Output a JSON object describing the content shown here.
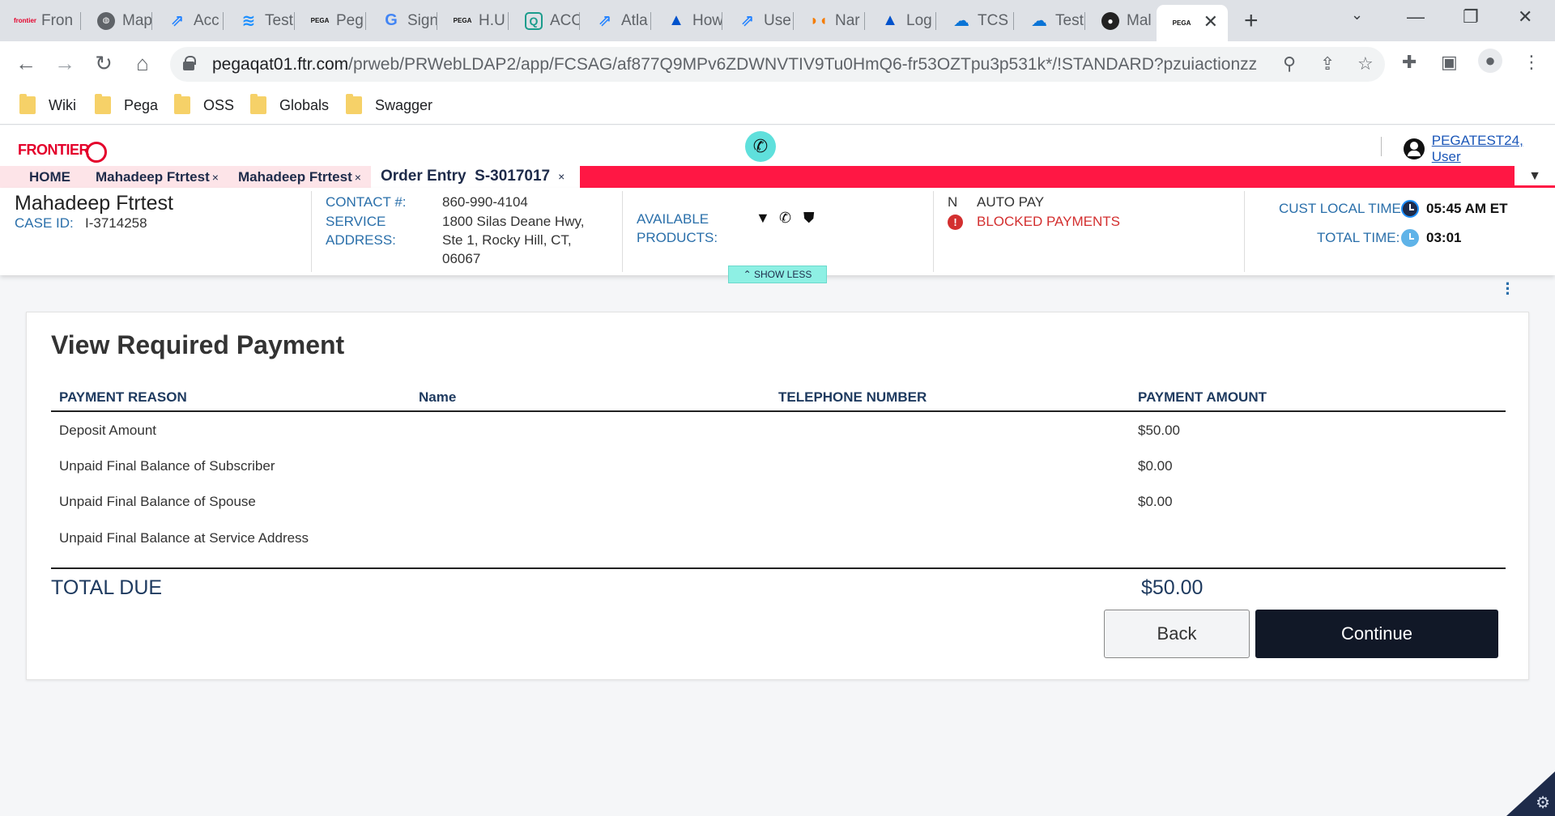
{
  "browser": {
    "tabs": [
      {
        "label": "Fron",
        "icon": "frontier-favicon"
      },
      {
        "label": "Map",
        "icon": "globe-favicon"
      },
      {
        "label": "Acc",
        "icon": "jira-favicon"
      },
      {
        "label": "Test",
        "icon": "feather-favicon"
      },
      {
        "label": "Peg",
        "icon": "pega-favicon"
      },
      {
        "label": "Sign",
        "icon": "google-favicon"
      },
      {
        "label": "H.U",
        "icon": "pega-favicon"
      },
      {
        "label": "ACC",
        "icon": "q-favicon"
      },
      {
        "label": "Atla",
        "icon": "jira-favicon"
      },
      {
        "label": "How",
        "icon": "atlassian-favicon"
      },
      {
        "label": "Use",
        "icon": "jira-favicon"
      },
      {
        "label": "Nar",
        "icon": "mask-favicon"
      },
      {
        "label": "Log",
        "icon": "atlassian-favicon"
      },
      {
        "label": "TCS",
        "icon": "cloud-favicon"
      },
      {
        "label": "Test",
        "icon": "cloud-favicon"
      },
      {
        "label": "Mal",
        "icon": "github-favicon"
      },
      {
        "label": "",
        "icon": "pega-favicon"
      }
    ],
    "pega_badge": "PEGA",
    "frontier_badge": "frontier",
    "url_host": "pegaqat01.ftr.com",
    "url_path": "/prweb/PRWebLDAP2/app/FCSAG/af877Q9MPv6ZDWNVTIV9Tu0HmQ6-fr53OZTpu3p531k*/!STANDARD?pzuiactionzzz...",
    "bookmarks": [
      "Wiki",
      "Pega",
      "OSS",
      "Globals",
      "Swagger"
    ]
  },
  "app": {
    "logo_text": "FRONTIER",
    "user_label": "PEGATEST24, User",
    "tabs": [
      {
        "label": "HOME"
      },
      {
        "label": "Mahadeep Ftrtest"
      },
      {
        "label": "Mahadeep Ftrtest"
      },
      {
        "label": "Order Entry  S-3017017"
      }
    ],
    "close_glyph": "×",
    "menu_glyph": "▼"
  },
  "summary": {
    "customer_name": "Mahadeep Ftrtest",
    "case_id_label": "CASE ID:",
    "case_id": "I-3714258",
    "contact_label": "CONTACT #:",
    "contact": "860-990-4104",
    "service_address_label_1": "SERVICE",
    "service_address_label_2": "ADDRESS:",
    "address_line1": "1800 Silas Deane Hwy,",
    "address_line2": "Ste 1, Rocky Hill, CT,",
    "address_line3": "06067",
    "products_label_1": "AVAILABLE",
    "products_label_2": "PRODUCTS:",
    "autopay_flag": "N",
    "autopay_label": "AUTO PAY",
    "blocked_label": "BLOCKED PAYMENTS",
    "cust_time_label": "CUST LOCAL TIME:",
    "cust_time": "05:45 AM ET",
    "total_time_label": "TOTAL TIME:",
    "total_time": "03:01",
    "show_less": "SHOW LESS"
  },
  "payment": {
    "title": "View Required Payment",
    "headers": [
      "PAYMENT REASON",
      "Name",
      "TELEPHONE NUMBER",
      "PAYMENT AMOUNT"
    ],
    "rows": [
      {
        "reason": "Deposit Amount",
        "amount": "$50.00"
      },
      {
        "reason": "Unpaid Final Balance of Subscriber",
        "amount": "$0.00"
      },
      {
        "reason": "Unpaid Final Balance of Spouse",
        "amount": "$0.00"
      },
      {
        "reason": "Unpaid Final Balance at Service Address",
        "amount": ""
      }
    ],
    "total_label": "TOTAL DUE",
    "total_value": "$50.00",
    "back_label": "Back",
    "continue_label": "Continue"
  },
  "colors": {
    "brand_red": "#e4002b",
    "tab_bar": "#ff1744",
    "label_blue": "#2a6faa",
    "alert_red": "#d32f2f",
    "continue_bg": "#111827"
  }
}
